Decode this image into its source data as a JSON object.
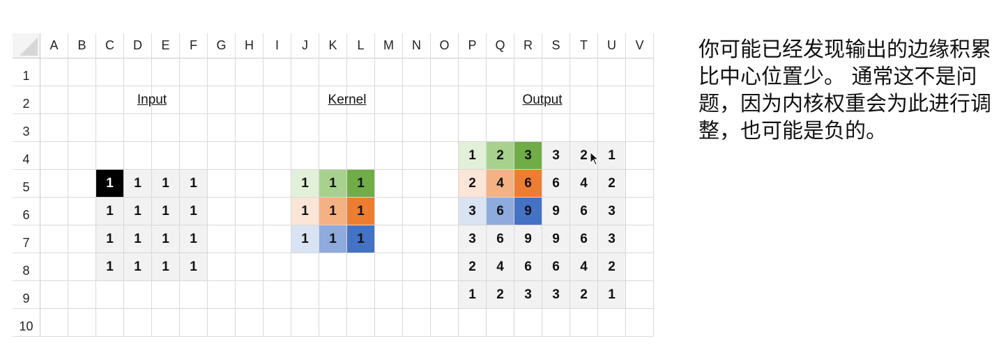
{
  "spreadsheet": {
    "column_headers": [
      "A",
      "B",
      "C",
      "D",
      "E",
      "F",
      "G",
      "H",
      "I",
      "J",
      "K",
      "L",
      "M",
      "N",
      "O",
      "P",
      "Q",
      "R",
      "S",
      "T",
      "U",
      "V"
    ],
    "row_headers": [
      "1",
      "2",
      "3",
      "4",
      "5",
      "6",
      "7",
      "8",
      "9",
      "10"
    ],
    "titles": {
      "input": "Input",
      "kernel": "Kernel",
      "output": "Output"
    },
    "input_matrix": [
      [
        "1",
        "1",
        "1",
        "1"
      ],
      [
        "1",
        "1",
        "1",
        "1"
      ],
      [
        "1",
        "1",
        "1",
        "1"
      ],
      [
        "1",
        "1",
        "1",
        "1"
      ]
    ],
    "kernel_matrix": [
      [
        "1",
        "1",
        "1"
      ],
      [
        "1",
        "1",
        "1"
      ],
      [
        "1",
        "1",
        "1"
      ]
    ],
    "output_matrix": [
      [
        "1",
        "2",
        "3",
        "3",
        "2",
        "1"
      ],
      [
        "2",
        "4",
        "6",
        "6",
        "4",
        "2"
      ],
      [
        "3",
        "6",
        "9",
        "9",
        "6",
        "3"
      ],
      [
        "3",
        "6",
        "9",
        "9",
        "6",
        "3"
      ],
      [
        "2",
        "4",
        "6",
        "6",
        "4",
        "2"
      ],
      [
        "1",
        "2",
        "3",
        "3",
        "2",
        "1"
      ]
    ],
    "colors": {
      "kernel": [
        [
          "#e2f0d9",
          "#a9d18e",
          "#70ad47"
        ],
        [
          "#fbe5d6",
          "#f4b183",
          "#ed7d31"
        ],
        [
          "#dae3f3",
          "#8faadc",
          "#4472c4"
        ]
      ],
      "input_highlight_bg": "#000000",
      "input_highlight_fg": "#ffffff",
      "block_bg": "#f2f2f2"
    }
  },
  "caption": "你可能已经发现输出的边缘积累比中心位置少。 通常这不是问题，因为内核权重会为此进行调整，也可能是负的。"
}
